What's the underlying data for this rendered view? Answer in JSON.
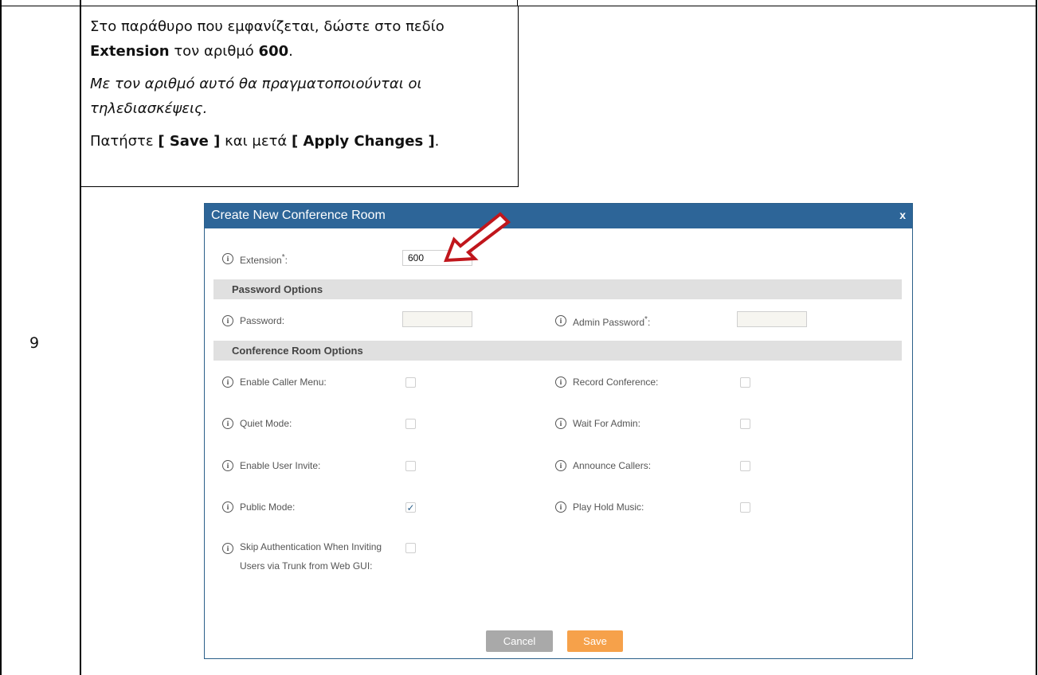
{
  "step": {
    "number": "9"
  },
  "instruction": {
    "p1_before": "Στο παράθυρο που εμφανίζεται, δώστε στο πεδίο ",
    "p1_field": "Extension",
    "p1_middle": " τον αριθμό ",
    "p1_value": "600",
    "p1_end": ".",
    "p2": "Με τον αριθμό αυτό θα πραγματοποιούνται οι τηλεδιασκέψεις.",
    "p3_before": "Πατήστε ",
    "p3_save": "[ Save ]",
    "p3_middle": " και μετά ",
    "p3_apply": "[ Apply Changes ]",
    "p3_end": "."
  },
  "dialog": {
    "title": "Create New Conference Room",
    "close": "x",
    "extension": {
      "label": "Extension",
      "required": "*",
      "colon": ":",
      "value": "600"
    },
    "password_section": "Password Options",
    "password": {
      "label": "Password:",
      "value": ""
    },
    "admin_password": {
      "label": "Admin Password",
      "required": "*",
      "colon": ":",
      "value": ""
    },
    "options_section": "Conference Room Options",
    "options": {
      "enable_caller_menu": {
        "label": "Enable Caller Menu:",
        "checked": false
      },
      "record_conference": {
        "label": "Record Conference:",
        "checked": false
      },
      "quiet_mode": {
        "label": "Quiet Mode:",
        "checked": false
      },
      "wait_for_admin": {
        "label": "Wait For Admin:",
        "checked": false
      },
      "enable_user_invite": {
        "label": "Enable User Invite:",
        "checked": false
      },
      "announce_callers": {
        "label": "Announce Callers:",
        "checked": false
      },
      "public_mode": {
        "label": "Public Mode:",
        "checked": true,
        "mark": "✓"
      },
      "play_hold_music": {
        "label": "Play Hold Music:",
        "checked": false
      },
      "skip_auth": {
        "label": "Skip Authentication When Inviting Users via Trunk from Web GUI:",
        "checked": false
      }
    },
    "info_glyph": "i",
    "cancel_label": "Cancel",
    "save_label": "Save"
  },
  "colors": {
    "header": "#2d6598",
    "save_button": "#f6a14a",
    "cancel_button": "#a9a9a9",
    "section_bar": "#e0e0e0",
    "arrow": "#c0161c"
  },
  "icons": {
    "info": "info-circle-icon",
    "close": "close-icon",
    "arrow": "arrow-pointer-icon",
    "check": "checkmark-icon"
  }
}
